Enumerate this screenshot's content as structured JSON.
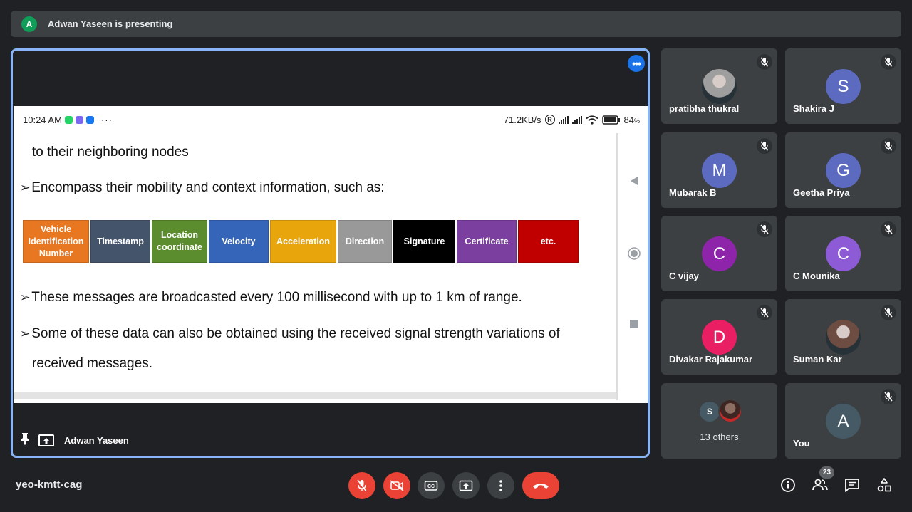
{
  "banner": {
    "avatar_letter": "A",
    "text": "Adwan Yaseen is presenting"
  },
  "phone": {
    "time": "10:24 AM",
    "dots": "···",
    "speed": "71.2KB/s",
    "reg": "R",
    "battery": "84",
    "battery_unit": "%"
  },
  "slide": {
    "line1": "to their neighboring nodes",
    "line2": "Encompass their mobility and context information, such as:",
    "line3": "These  messages are broadcasted every 100 millisecond with up to 1 km of range.",
    "line4": "Some of these data can also be obtained using the received signal strength variations of",
    "line5": "received messages.",
    "bullet": "➢",
    "boxes": [
      {
        "label": "Vehicle Identification Number",
        "color": "#e87722"
      },
      {
        "label": "Timestamp",
        "color": "#44546a"
      },
      {
        "label": "Location coordinate",
        "color": "#5b8c2e"
      },
      {
        "label": "Velocity",
        "color": "#3565b8"
      },
      {
        "label": "Acceleration",
        "color": "#e8a60c"
      },
      {
        "label": "Direction",
        "color": "#999999"
      },
      {
        "label": "Signature",
        "color": "#000000"
      },
      {
        "label": "Certificate",
        "color": "#7b3fa0"
      },
      {
        "label": "etc.",
        "color": "#c00000"
      }
    ]
  },
  "presenter": {
    "name": "Adwan Yaseen"
  },
  "participants": [
    {
      "name": "pratibha thukral",
      "letter": "",
      "color": "#9e9e9e",
      "photo": true
    },
    {
      "name": "Shakira J",
      "letter": "S",
      "color": "#5c6bc0"
    },
    {
      "name": "Mubarak B",
      "letter": "M",
      "color": "#5c6bc0"
    },
    {
      "name": "Geetha Priya",
      "letter": "G",
      "color": "#5c6bc0"
    },
    {
      "name": "C vijay",
      "letter": "C",
      "color": "#8e24aa"
    },
    {
      "name": "C Mounika",
      "letter": "C",
      "color": "#8e5bd6"
    },
    {
      "name": "Divakar Rajakumar",
      "letter": "D",
      "color": "#e91e63"
    },
    {
      "name": "Suman Kar",
      "letter": "",
      "color": "#6d4c41",
      "photo": true
    }
  ],
  "others": {
    "label": "13 others",
    "letter": "S"
  },
  "you": {
    "name": "You",
    "letter": "A",
    "color": "#455a64"
  },
  "meeting": {
    "code": "yeo-kmtt-cag",
    "participant_count": "23"
  },
  "colors": {
    "accent": "#8ab4f8",
    "danger": "#ea4335",
    "tile": "#3c4043",
    "bg": "#202124"
  }
}
